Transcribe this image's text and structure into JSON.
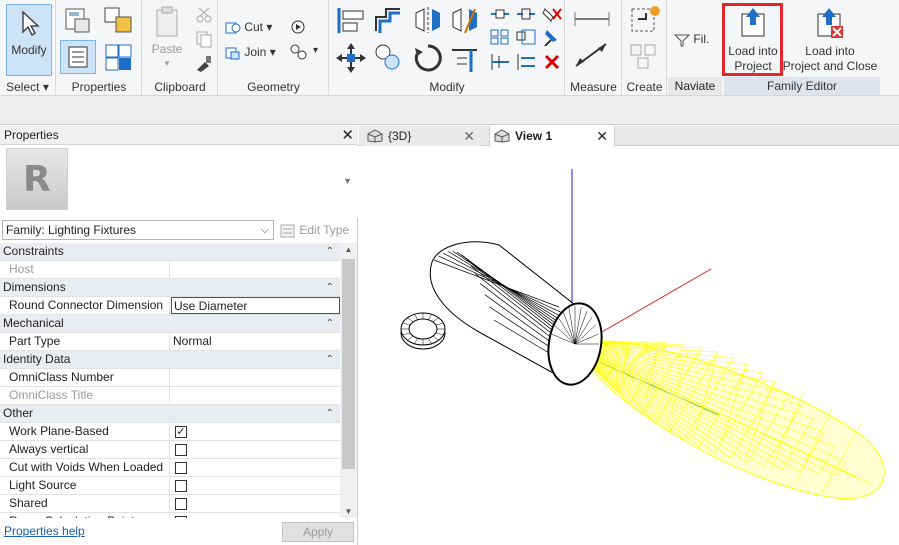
{
  "ribbon": {
    "groups": {
      "select": "Select",
      "properties": "Properties",
      "clipboard": "Clipboard",
      "geometry": "Geometry",
      "modify": "Modify",
      "measure": "Measure",
      "create": "Create",
      "naviate": "Naviate",
      "family_editor": "Family Editor"
    },
    "modify_button": "Modify",
    "paste_button": "Paste",
    "cut_button": "Cut",
    "join_button": "Join",
    "filter_button": "Fil.",
    "load_into_project": [
      "Load into",
      "Project"
    ],
    "load_into_project_close": [
      "Load into",
      "Project and Close"
    ],
    "accent_color": "#1f6fc5",
    "highlight_color": "#e0282e"
  },
  "properties_panel": {
    "title": "Properties",
    "family_select": "Family: Lighting Fixtures",
    "edit_type": "Edit Type",
    "help_link": "Properties help",
    "apply_button": "Apply",
    "rows": [
      {
        "kind": "category",
        "label": "Constraints"
      },
      {
        "kind": "param",
        "name": "Host",
        "value": "",
        "grey": true
      },
      {
        "kind": "category",
        "label": "Dimensions"
      },
      {
        "kind": "param",
        "name": "Round Connector Dimension",
        "value": "Use Diameter",
        "editing": true
      },
      {
        "kind": "category",
        "label": "Mechanical"
      },
      {
        "kind": "param",
        "name": "Part Type",
        "value": "Normal"
      },
      {
        "kind": "category",
        "label": "Identity Data"
      },
      {
        "kind": "param",
        "name": "OmniClass Number",
        "value": ""
      },
      {
        "kind": "param",
        "name": "OmniClass Title",
        "value": "",
        "grey": true
      },
      {
        "kind": "category",
        "label": "Other"
      },
      {
        "kind": "check",
        "name": "Work Plane-Based",
        "checked": true
      },
      {
        "kind": "check",
        "name": "Always vertical",
        "checked": false
      },
      {
        "kind": "check",
        "name": "Cut with Voids When Loaded",
        "checked": false
      },
      {
        "kind": "check",
        "name": "Light Source",
        "checked": false
      },
      {
        "kind": "check",
        "name": "Shared",
        "checked": false
      },
      {
        "kind": "check",
        "name": "Room Calculation Point",
        "checked": false
      }
    ]
  },
  "view_tabs": [
    {
      "label": "{3D}",
      "active": false
    },
    {
      "label": "View 1",
      "active": true
    }
  ],
  "scene": {
    "axis_colors": {
      "z": "#1a1aff",
      "x": "#e02020",
      "y": "#20b020"
    },
    "light_color": "#ffff00",
    "fixture_color": "#000000"
  }
}
